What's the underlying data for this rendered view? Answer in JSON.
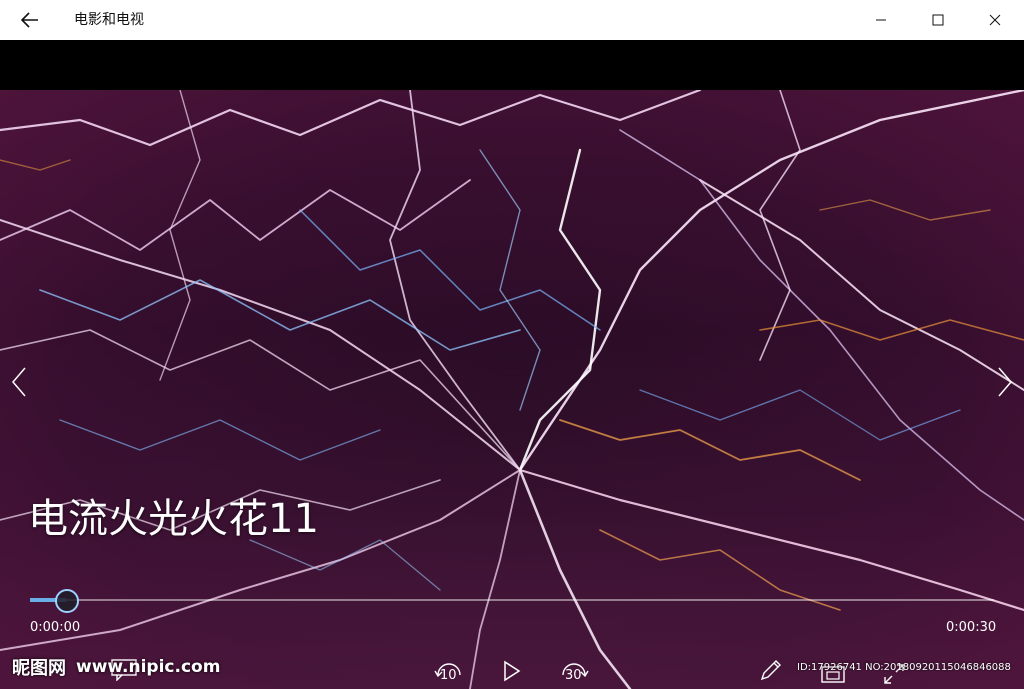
{
  "app": {
    "title": "电影和电视"
  },
  "window_controls": {
    "minimize": "minimize-icon",
    "maximize": "maximize-icon",
    "close": "close-icon"
  },
  "video": {
    "title": "电流火光火花11",
    "current_time": "0:00:00",
    "duration": "0:00:30",
    "progress": 0.0
  },
  "controls": {
    "skip_back_label": "10",
    "skip_forward_label": "30"
  },
  "watermark": {
    "logo_text": "昵图网",
    "url_text": "www.nipic.com",
    "id_text": "ID:17926741 NO:20180920115046846088"
  },
  "colors": {
    "seek_fill": "#6aaee8",
    "seek_thumb_border": "#9fd0ff",
    "titlebar_bg": "#ffffff"
  }
}
